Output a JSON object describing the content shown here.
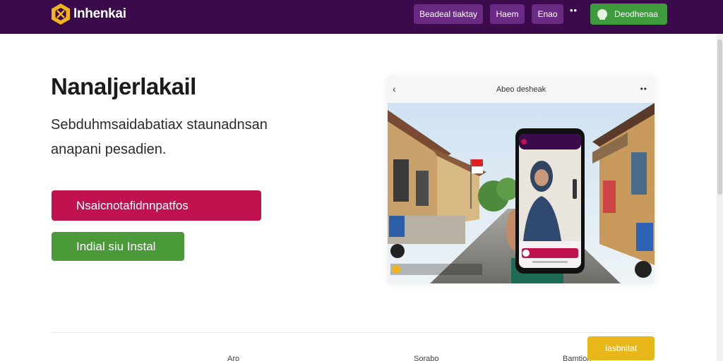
{
  "header": {
    "brand": "Inhenkai",
    "nav": [
      "Beadeal tiaktay",
      "Haem",
      "Enao"
    ],
    "more": "••",
    "signin_label": "Deodhenaa"
  },
  "hero": {
    "title": "Nanaljerlakail",
    "subtitle": "Sebduhmsaidabatiax staunadnsan anapani pesadien.",
    "primary_cta": "Nsaicnotafidnnpatfos",
    "secondary_cta": "Indial siu Instal"
  },
  "preview": {
    "title": "Abeo desheak",
    "back": "‹",
    "more": "••"
  },
  "footer": {
    "labels": [
      "Aro",
      "Sorabo",
      "Bamtion"
    ],
    "install_label": "Iasbnitat"
  },
  "colors": {
    "topbar": "#3a0a4a",
    "nav_button": "#6a2a84",
    "signin": "#3d9a3d",
    "primary_cta": "#c0124e",
    "secondary_cta": "#4a9a3a",
    "install": "#e8b81a"
  }
}
